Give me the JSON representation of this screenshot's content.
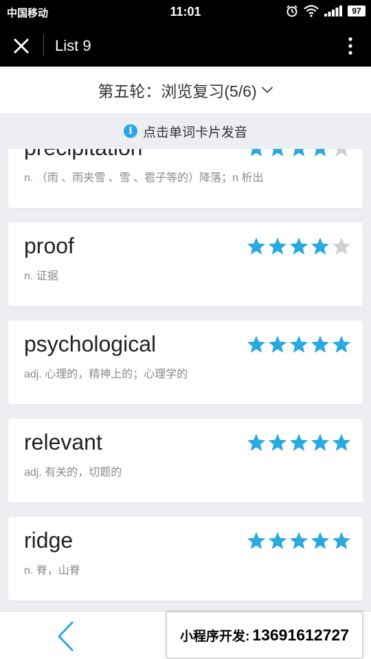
{
  "status_bar": {
    "carrier": "中国移动",
    "time": "11:01",
    "battery": "97"
  },
  "nav": {
    "title": "List 9",
    "close_icon": "close-icon",
    "more_icon": "more-vertical-icon"
  },
  "round": {
    "title": "第五轮：浏览复习(5/6)"
  },
  "hint": {
    "text": "点击单词卡片发音"
  },
  "colors": {
    "star_on": "#2aa8e0",
    "star_off": "#d0d0d0",
    "accent": "#2aa6e6"
  },
  "words": [
    {
      "word": "precipitation",
      "definition": "n. （雨 、雨夹雪 、雪 、雹子等的）降落；n 析出",
      "rating": 4
    },
    {
      "word": "proof",
      "definition": "n. 证据",
      "rating": 4
    },
    {
      "word": "psychological",
      "definition": "adj. 心理的，精神上的；心理学的",
      "rating": 5
    },
    {
      "word": "relevant",
      "definition": "adj. 有关的，切题的",
      "rating": 5
    },
    {
      "word": "ridge",
      "definition": "n. 脊，山脊",
      "rating": 5
    }
  ],
  "promo": {
    "label": "小程序开发:",
    "phone": "13691612727"
  }
}
